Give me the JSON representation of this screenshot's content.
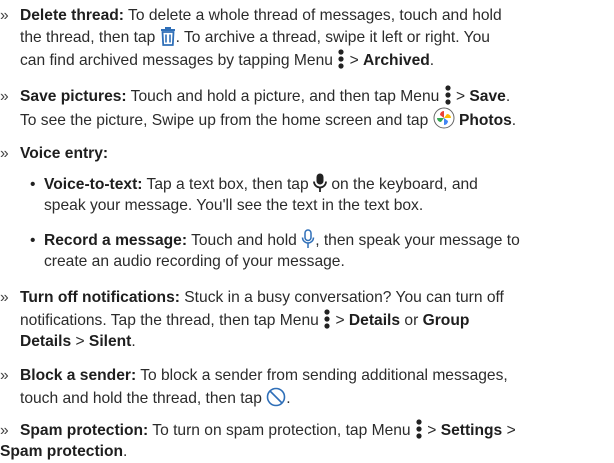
{
  "bullet": "»",
  "sub_bullet": "•",
  "colors": {
    "accent": "#2f6fb8",
    "text": "#2b2b2b"
  },
  "icons": {
    "trash": "trash-icon",
    "menu": "menu-dots-icon",
    "photos": "photos-app-icon",
    "mic_filled": "microphone-icon",
    "mic_outline": "microphone-outline-icon",
    "block": "block-icon"
  },
  "delete": {
    "title": "Delete thread:",
    "t1": " To delete a whole thread of messages, touch and hold",
    "t2": "the thread, then tap ",
    "t3": ". To archive a thread, swipe it left or right. You",
    "t4": "can find archived messages by tapping Menu ",
    "sep": " > ",
    "archived": "Archived",
    "end": "."
  },
  "save": {
    "title": "Save pictures:",
    "t1": " Touch and hold a picture, and then tap Menu ",
    "sep": " > ",
    "save": "Save",
    "end": ".",
    "t2": "To see the picture, Swipe up from the home screen and tap ",
    "photos": "Photos",
    "end2": "."
  },
  "voice": {
    "title": "Voice entry:"
  },
  "vtt": {
    "title": "Voice-to-text:",
    "t1": " Tap a text box, then tap ",
    "t2": " on the keyboard, and",
    "t3": "speak your message. You'll see the text in the text box."
  },
  "record": {
    "title": "Record a message:",
    "t1": " Touch and hold ",
    "t2": ", then speak your message to",
    "t3": "create an audio recording of your message."
  },
  "notif": {
    "title": "Turn off notifications:",
    "t1": " Stuck in a busy conversation? You can turn off",
    "t2": "notifications. Tap the thread, then tap Menu ",
    "sep": " > ",
    "details": "Details",
    "or": " or ",
    "group": "Group",
    "details2": "Details",
    "sep2": " > ",
    "silent": "Silent",
    "end": "."
  },
  "block": {
    "title": "Block a sender:",
    "t1": " To block a sender from sending additional messages,",
    "t2": "touch and hold the thread, then tap ",
    "end": "."
  },
  "spam": {
    "title": "Spam protection:",
    "t1": " To turn on spam protection, tap Menu ",
    "sep": " > ",
    "settings": "Settings",
    "sep2": " >",
    "spam": "Spam protection",
    "end": "."
  }
}
